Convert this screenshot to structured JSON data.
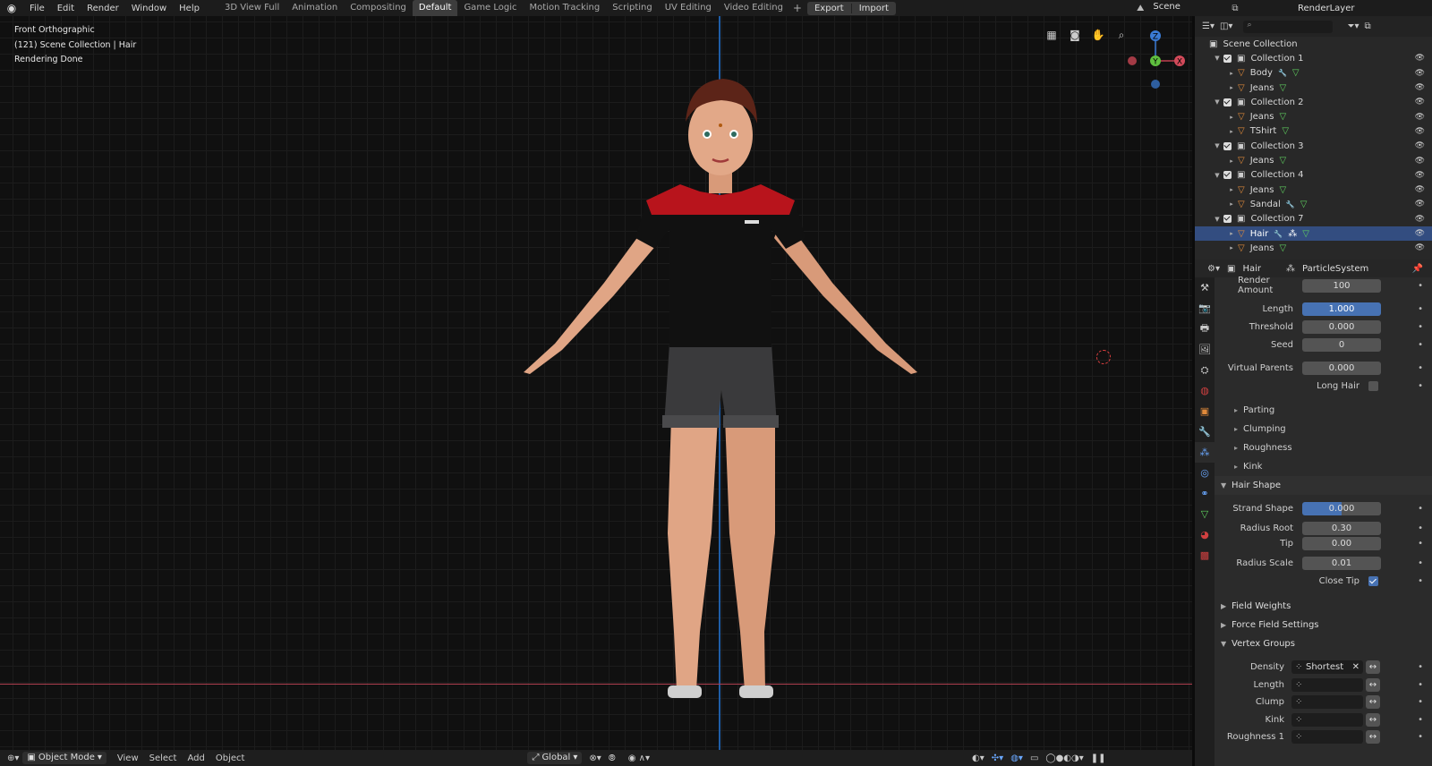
{
  "menu": [
    "File",
    "Edit",
    "Render",
    "Window",
    "Help"
  ],
  "workspaces": [
    "3D View Full",
    "Animation",
    "Compositing",
    "Default",
    "Game Logic",
    "Motion Tracking",
    "Scripting",
    "UV Editing",
    "Video Editing"
  ],
  "active_workspace": "Default",
  "export_label": "Export",
  "import_label": "Import",
  "scene": "Scene",
  "render_layer": "RenderLayer",
  "viewport": {
    "view": "Front Orthographic",
    "collection": "(121) Scene Collection | Hair",
    "status": "Rendering Done",
    "gizmo": {
      "z": "Z",
      "y": "Y",
      "x": "X"
    }
  },
  "bottombar": {
    "mode": "Object Mode",
    "menus": [
      "View",
      "Select",
      "Add",
      "Object"
    ],
    "orientation": "Global"
  },
  "outliner": {
    "root": "Scene Collection",
    "rows": [
      {
        "label": "Collection 1",
        "type": "collection"
      },
      {
        "label": "Body",
        "type": "object",
        "mod": true
      },
      {
        "label": "Jeans",
        "type": "object"
      },
      {
        "label": "Collection 2",
        "type": "collection"
      },
      {
        "label": "Jeans",
        "type": "object"
      },
      {
        "label": "TShirt",
        "type": "object"
      },
      {
        "label": "Collection 3",
        "type": "collection"
      },
      {
        "label": "Jeans",
        "type": "object"
      },
      {
        "label": "Collection 4",
        "type": "collection"
      },
      {
        "label": "Jeans",
        "type": "object"
      },
      {
        "label": "Sandal",
        "type": "object",
        "mod": true
      },
      {
        "label": "Collection 7",
        "type": "collection"
      },
      {
        "label": "Hair",
        "type": "object",
        "mod": true,
        "selected": true
      },
      {
        "label": "Jeans",
        "type": "object"
      }
    ]
  },
  "properties": {
    "object": "Hair",
    "system": "ParticleSystem",
    "render_amount": {
      "label": "Render Amount",
      "value": "100"
    },
    "length": {
      "label": "Length",
      "value": "1.000"
    },
    "threshold": {
      "label": "Threshold",
      "value": "0.000"
    },
    "seed": {
      "label": "Seed",
      "value": "0"
    },
    "virtual_parents": {
      "label": "Virtual Parents",
      "value": "0.000"
    },
    "long_hair": "Long Hair",
    "subpanels": [
      "Parting",
      "Clumping",
      "Roughness",
      "Kink"
    ],
    "hair_shape": "Hair Shape",
    "strand_shape": {
      "label": "Strand Shape",
      "value": "0.000"
    },
    "radius_root": {
      "label": "Radius Root",
      "value": "0.30"
    },
    "tip": {
      "label": "Tip",
      "value": "0.00"
    },
    "radius_scale": {
      "label": "Radius Scale",
      "value": "0.01"
    },
    "close_tip": "Close Tip",
    "field_weights": "Field Weights",
    "force_field": "Force Field Settings",
    "vertex_groups": "Vertex Groups",
    "vgroups": [
      {
        "label": "Density",
        "value": "Shortest"
      },
      {
        "label": "Length",
        "value": ""
      },
      {
        "label": "Clump",
        "value": ""
      },
      {
        "label": "Kink",
        "value": ""
      },
      {
        "label": "Roughness 1",
        "value": ""
      }
    ]
  }
}
